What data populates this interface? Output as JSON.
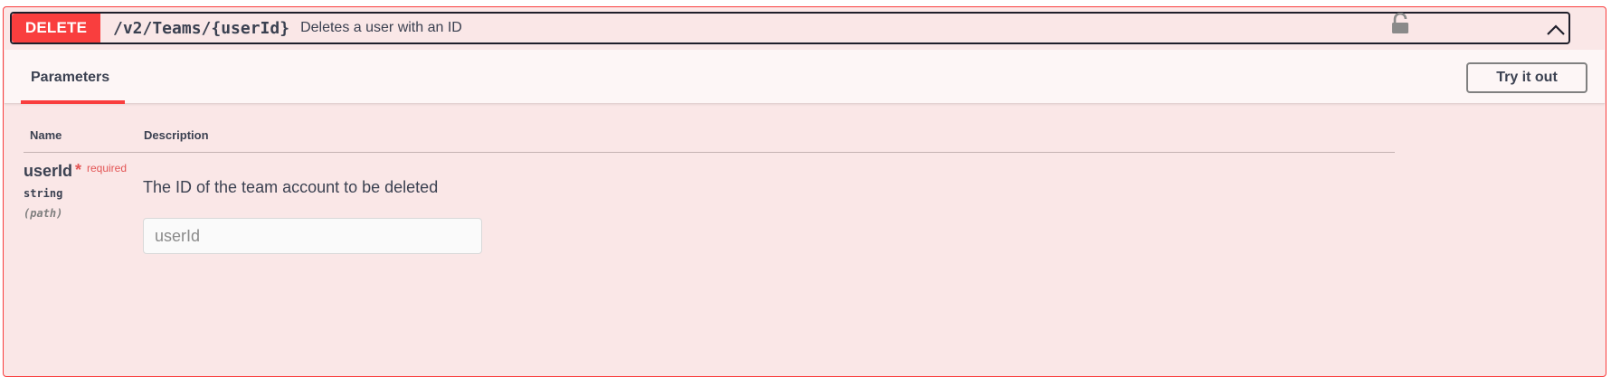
{
  "operation": {
    "method": "DELETE",
    "path": "/v2/Teams/{userId}",
    "summary": "Deletes a user with an ID"
  },
  "tabs": {
    "parameters_label": "Parameters"
  },
  "buttons": {
    "try_it_out": "Try it out"
  },
  "table": {
    "headers": {
      "name": "Name",
      "description": "Description"
    },
    "params": [
      {
        "name": "userId",
        "required_marker": "*",
        "required_label": "required",
        "type": "string",
        "location": "(path)",
        "description": "The ID of the team account to be deleted",
        "input_placeholder": "userId",
        "input_value": ""
      }
    ]
  },
  "icons": {
    "collapse": "chevron-up-icon",
    "auth": "unlocked-padlock-icon"
  },
  "colors": {
    "method_delete": "#f93e3e",
    "block_background": "#fae7e7",
    "required": "#e35555",
    "text": "#3b4151"
  }
}
